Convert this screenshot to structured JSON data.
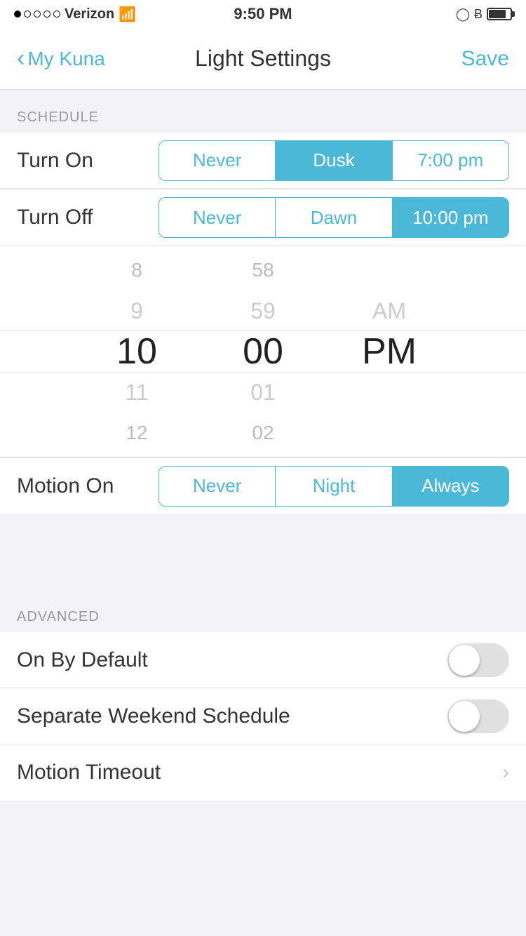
{
  "statusBar": {
    "carrier": "Verizon",
    "time": "9:50 PM",
    "wifi": true,
    "battery": 75
  },
  "nav": {
    "back_label": "My Kuna",
    "title": "Light Settings",
    "save_label": "Save"
  },
  "schedule": {
    "section_label": "SCHEDULE",
    "turnOn": {
      "label": "Turn On",
      "options": [
        "Never",
        "Dusk",
        "7:00 pm"
      ],
      "selected": 1
    },
    "turnOff": {
      "label": "Turn Off",
      "options": [
        "Never",
        "Dawn",
        "10:00 pm"
      ],
      "selected": 2
    },
    "timePicker": {
      "hours": [
        "8",
        "9",
        "10",
        "11",
        "12"
      ],
      "minutes": [
        "58",
        "59",
        "00",
        "01",
        "02"
      ],
      "ampm": [
        "AM",
        "PM"
      ],
      "selected_hour": "10",
      "selected_minute": "00",
      "selected_ampm": "PM"
    },
    "motionOn": {
      "label": "Motion On",
      "options": [
        "Never",
        "Night",
        "Always"
      ],
      "selected": 2
    }
  },
  "advanced": {
    "section_label": "ADVANCED",
    "onByDefault": {
      "label": "On By Default",
      "enabled": false
    },
    "separateWeekend": {
      "label": "Separate Weekend Schedule",
      "enabled": false
    },
    "motionTimeout": {
      "label": "Motion Timeout"
    }
  }
}
